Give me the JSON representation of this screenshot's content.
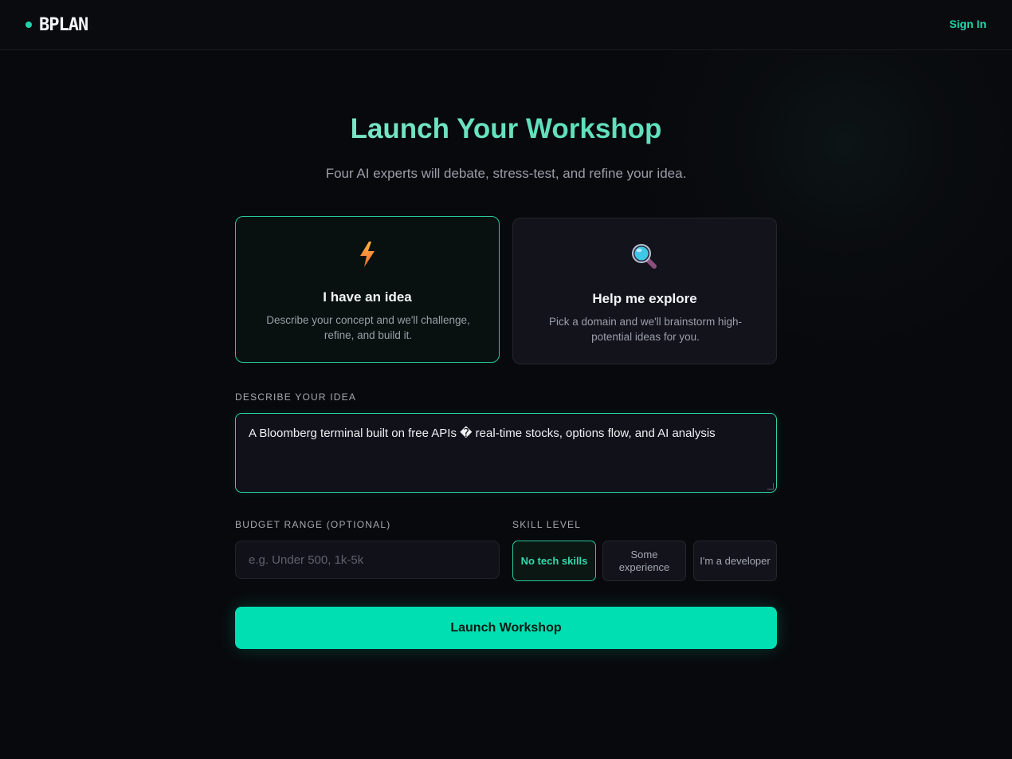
{
  "header": {
    "brand": "BPLAN",
    "sign_in": "Sign In"
  },
  "hero": {
    "title": "Launch Your Workshop",
    "subtitle": "Four AI experts will debate, stress-test, and refine your idea."
  },
  "modes": [
    {
      "icon": "lightning-icon",
      "title": "I have an idea",
      "description": "Describe your concept and we'll challenge, refine, and build it.",
      "selected": true
    },
    {
      "icon": "magnifying-glass-icon",
      "title": "Help me explore",
      "description": "Pick a domain and we'll brainstorm high-potential ideas for you.",
      "selected": false
    }
  ],
  "idea": {
    "label": "DESCRIBE YOUR IDEA",
    "value": "A Bloomberg terminal built on free APIs � real-time stocks, options flow, and AI analysis"
  },
  "budget": {
    "label": "BUDGET RANGE (OPTIONAL)",
    "placeholder": "e.g. Under 500, 1k-5k",
    "value": ""
  },
  "skill": {
    "label": "SKILL LEVEL",
    "options": [
      "No tech skills",
      "Some experience",
      "I'm a developer"
    ],
    "selected": "No tech skills"
  },
  "launch_button": "Launch Workshop",
  "colors": {
    "accent": "#00dfb1",
    "background": "#08090d",
    "title_gradient_start": "#a7ecd9",
    "title_gradient_end": "#5fe0bc"
  }
}
